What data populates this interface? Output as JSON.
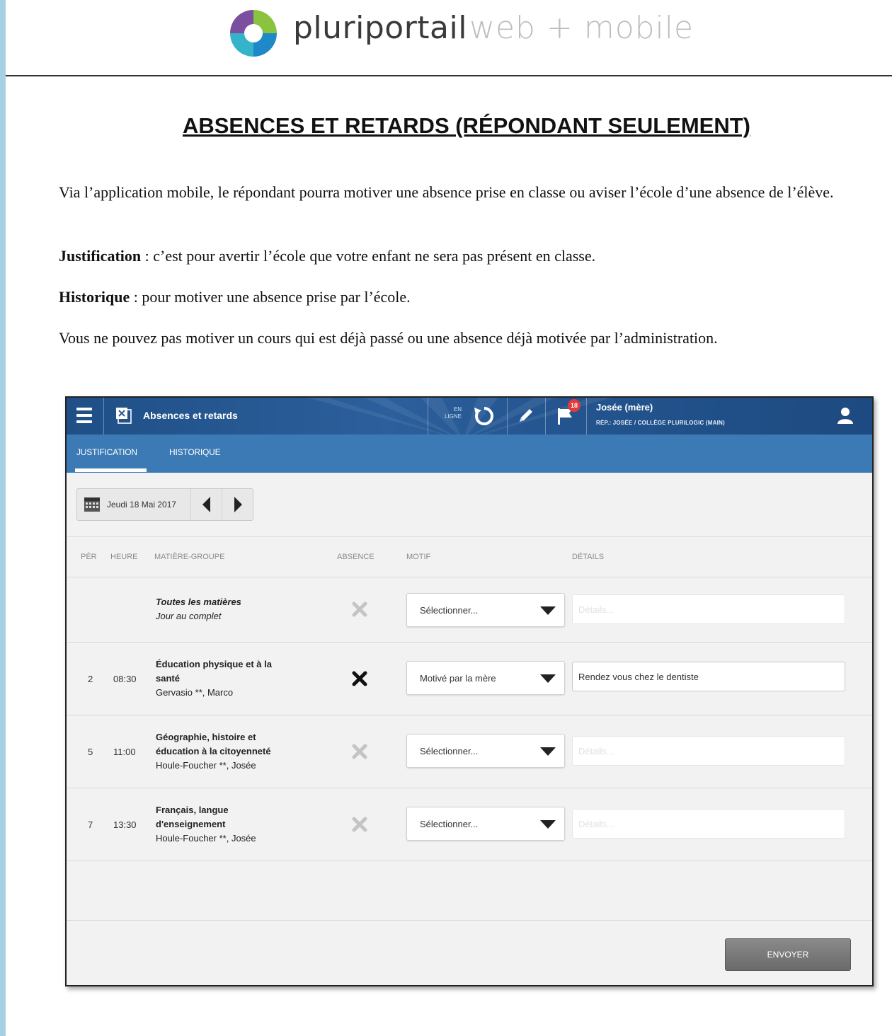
{
  "header": {
    "brand_name": "pluriportail",
    "brand_tag": "web + mobile"
  },
  "doc": {
    "title": "ABSENCES ET RETARDS (RÉPONDANT SEULEMENT)",
    "intro": "Via l’application mobile, le répondant pourra motiver une absence prise en classe ou aviser l’école d’une absence de l’élève.",
    "justification_term": "Justification",
    "justification_text": " : c’est pour avertir l’école que votre enfant ne sera pas présent en classe.",
    "historique_term": "Historique",
    "historique_text": " : pour motiver une absence prise par l’école.",
    "note": "Vous ne pouvez pas motiver un cours qui est déjà passé ou une absence déjà motivée par l’administration."
  },
  "app": {
    "title": "Absences et retards",
    "online_status_line1": "EN",
    "online_status_line2": "LIGNE",
    "notification_count": "18",
    "user_name": "Josée (mère)",
    "user_sub": "RÉP.: JOSÉE / COLLÈGE PLURILOGIC (MAIN)",
    "tabs": [
      {
        "label": "JUSTIFICATION"
      },
      {
        "label": "HISTORIQUE"
      }
    ],
    "date_label": "Jeudi 18 Mai 2017",
    "columns": {
      "per": "PÉR",
      "heure": "HEURE",
      "matiere": "MATIÈRE-GROUPE",
      "absence": "ABSENCE",
      "motif": "MOTIF",
      "details": "DÉTAILS"
    },
    "rows": [
      {
        "per": "",
        "heure": "",
        "subject_line1": "Toutes les matières",
        "subject_line2": "Jour au complet",
        "subject_line3": "",
        "motif": "Sélectionner...",
        "details_value": "",
        "details_placeholder": "Détails..."
      },
      {
        "per": "2",
        "heure": "08:30",
        "subject_line1": "Éducation physique et à la",
        "subject_line2": "santé",
        "subject_line3": "Gervasio **, Marco",
        "motif": "Motivé par la mère",
        "details_value": "Rendez vous chez le dentiste",
        "details_placeholder": "Détails..."
      },
      {
        "per": "5",
        "heure": "11:00",
        "subject_line1": "Géographie, histoire et",
        "subject_line2": "éducation à la citoyenneté",
        "subject_line3": "Houle-Foucher **, Josée",
        "motif": "Sélectionner...",
        "details_value": "",
        "details_placeholder": "Détails..."
      },
      {
        "per": "7",
        "heure": "13:30",
        "subject_line1": "Français, langue",
        "subject_line2": "d'enseignement",
        "subject_line3": "Houle-Foucher **, Josée",
        "motif": "Sélectionner...",
        "details_value": "",
        "details_placeholder": "Détails..."
      }
    ],
    "send_label": "ENVOYER"
  },
  "colors": {
    "topbar": "#245590",
    "tabbar": "#3b7ab5",
    "page_border": "#a9cfe2"
  }
}
